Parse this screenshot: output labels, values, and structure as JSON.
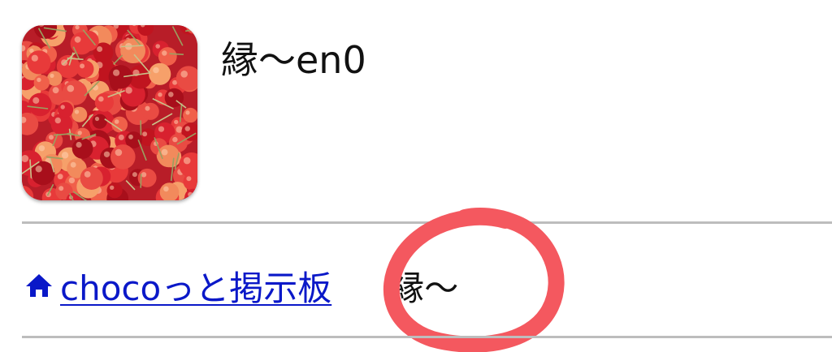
{
  "header": {
    "title": "縁〜en0",
    "avatar_icon": "cherries-photo"
  },
  "breadcrumb": {
    "home_icon": "home-icon",
    "link_label": "chocoっと掲示板",
    "current_label": "縁〜"
  },
  "colors": {
    "link": "#0a18c8",
    "divider": "#bdbdbd",
    "annotation": "#f4585f"
  }
}
